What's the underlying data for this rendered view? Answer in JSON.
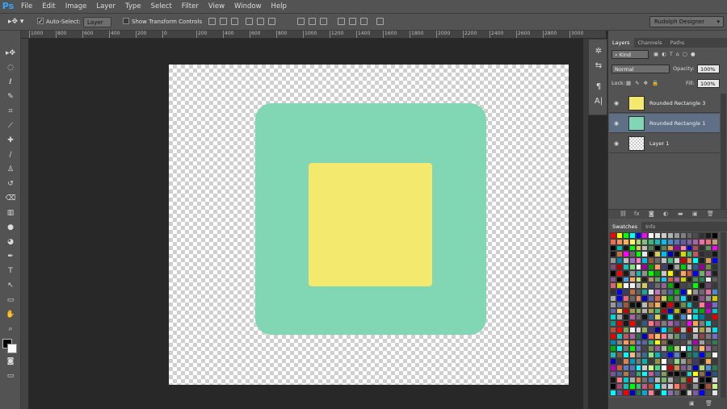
{
  "app": {
    "logo": "Ps"
  },
  "menu": [
    "File",
    "Edit",
    "Image",
    "Layer",
    "Type",
    "Select",
    "Filter",
    "View",
    "Window",
    "Help"
  ],
  "options": {
    "auto_select_label": "Auto-Select:",
    "auto_select_value": "Layer",
    "show_transform_label": "Show Transform Controls",
    "workspace": "Rudolph Designer"
  },
  "ruler": {
    "ticks": [
      "1000",
      "800",
      "600",
      "400",
      "200",
      "0",
      "200",
      "400",
      "600",
      "800",
      "1000",
      "1200",
      "1400",
      "1600",
      "1800",
      "2000",
      "2200",
      "2400",
      "2600",
      "2800",
      "3000"
    ]
  },
  "layers_panel": {
    "tabs": [
      "Layers",
      "Channels",
      "Paths"
    ],
    "filter": "Kind",
    "blend_mode": "Normal",
    "opacity_label": "Opacity:",
    "opacity": "100%",
    "lock_label": "Lock:",
    "fill_label": "Fill:",
    "fill": "100%",
    "layers": [
      {
        "name": "Rounded Rectangle 3",
        "color": "#f2e96e",
        "selected": false
      },
      {
        "name": "Rounded Rectangle 1",
        "color": "#81d6b3",
        "selected": true
      },
      {
        "name": "Layer 1",
        "color": "",
        "selected": false
      }
    ]
  },
  "swatches_panel": {
    "tabs": [
      "Swatches",
      "Info"
    ],
    "colors": [
      "#ff0000",
      "#ffff00",
      "#00ff00",
      "#00ffff",
      "#0000ff",
      "#ff00ff",
      "#ffffff",
      "#e6e6e6",
      "#cccccc",
      "#b3b3b3",
      "#999999",
      "#808080",
      "#666666",
      "#4d4d4d",
      "#333333",
      "#1a1a1a",
      "#000000",
      "#f26c4f",
      "#f68e55",
      "#fbaf5c",
      "#fff467",
      "#acd372",
      "#7cc576",
      "#3bb878",
      "#1abbb4",
      "#00bff3",
      "#438cca",
      "#5574b9",
      "#605ca8",
      "#855fa8",
      "#a763a8",
      "#f06ea9",
      "#f26d7d",
      "#c69c6d"
    ]
  },
  "canvas": {
    "rect_outer_color": "#81d6b3",
    "rect_inner_color": "#f2e96e"
  }
}
